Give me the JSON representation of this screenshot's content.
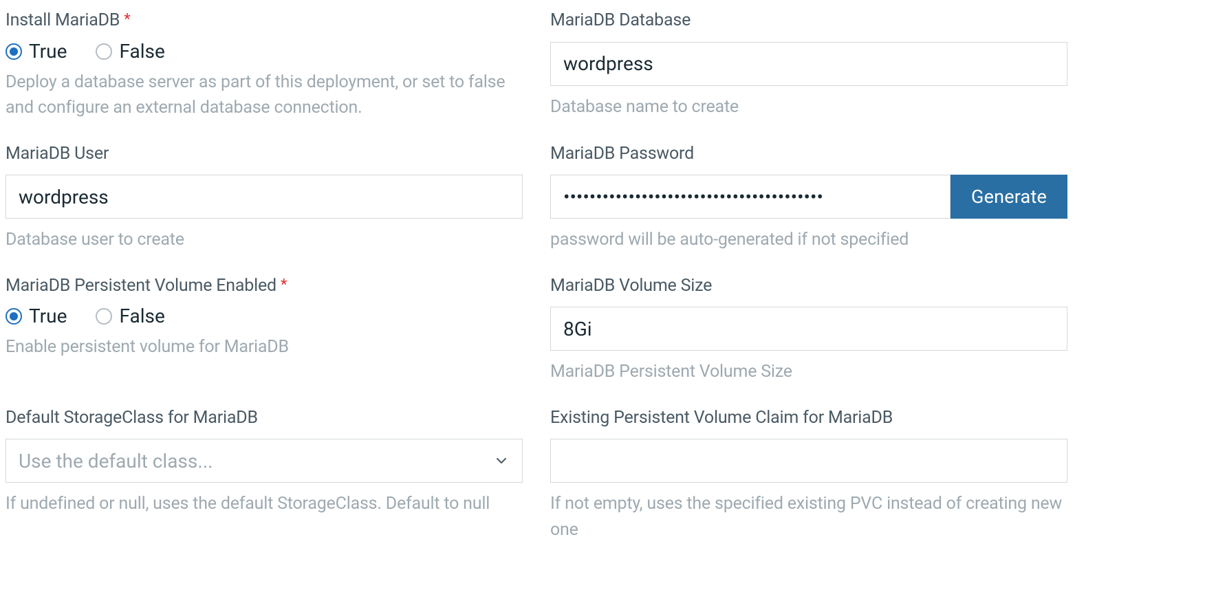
{
  "radio": {
    "true_label": "True",
    "false_label": "False"
  },
  "fields": {
    "install_mariadb": {
      "label": "Install MariaDB",
      "required": true,
      "value": "True",
      "help": "Deploy a database server as part of this deployment, or set to false and configure an external database connection."
    },
    "mariadb_database": {
      "label": "MariaDB Database",
      "value": "wordpress",
      "help": "Database name to create"
    },
    "mariadb_user": {
      "label": "MariaDB User",
      "value": "wordpress",
      "help": "Database user to create"
    },
    "mariadb_password": {
      "label": "MariaDB Password",
      "value": "••••••••••••••••••••••••••••••••••••••••",
      "button": "Generate",
      "help": "password will be auto-generated if not specified"
    },
    "mariadb_pv_enabled": {
      "label": "MariaDB Persistent Volume Enabled",
      "required": true,
      "value": "True",
      "help": "Enable persistent volume for MariaDB"
    },
    "mariadb_volume_size": {
      "label": "MariaDB Volume Size",
      "value": "8Gi",
      "help": "MariaDB Persistent Volume Size"
    },
    "default_storageclass": {
      "label": "Default StorageClass for MariaDB",
      "placeholder": "Use the default class...",
      "help": "If undefined or null, uses the default StorageClass. Default to null"
    },
    "existing_pvc": {
      "label": "Existing Persistent Volume Claim for MariaDB",
      "value": "",
      "help": "If not empty, uses the specified existing PVC instead of creating new one"
    }
  }
}
